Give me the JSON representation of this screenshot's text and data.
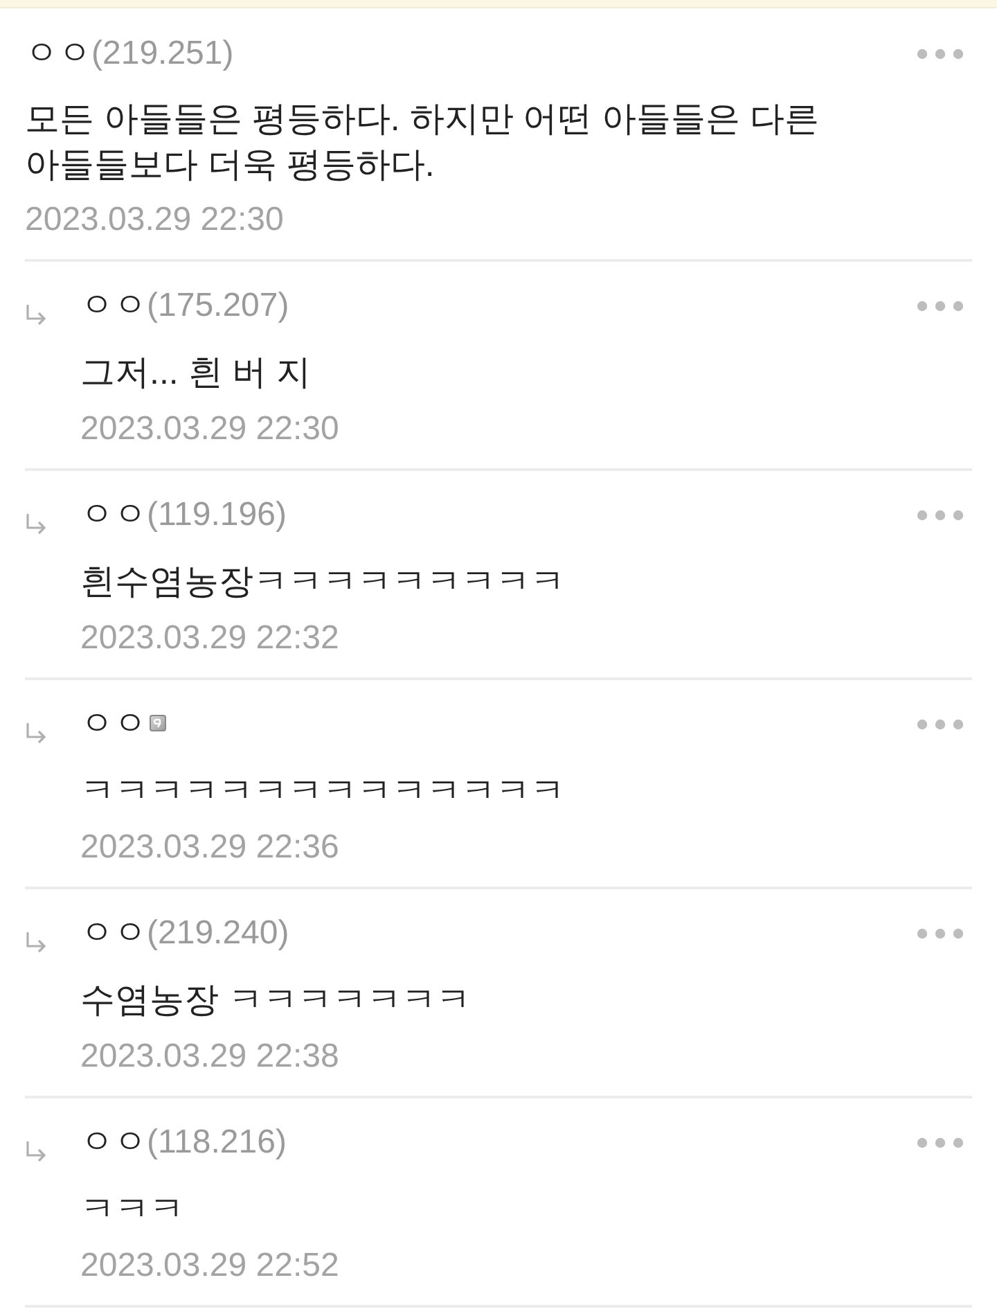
{
  "comment": {
    "nickname": "ㅇㅇ",
    "ip": "(219.251)",
    "text": "모든 아들들은 평등하다. 하지만 어떤 아들들은 다른 아들들보다 더욱 평등하다.",
    "date": "2023.03.29 22:30"
  },
  "replies": [
    {
      "kind": "guest",
      "nickname": "ㅇㅇ",
      "ip": "(175.207)",
      "text": "그저... 흰 버 지",
      "date": "2023.03.29 22:30"
    },
    {
      "kind": "guest",
      "nickname": "ㅇㅇ",
      "ip": "(119.196)",
      "text": "흰수염농장ㅋㅋㅋㅋㅋㅋㅋㅋㅋ",
      "date": "2023.03.29 22:32"
    },
    {
      "kind": "member",
      "nickname": "ㅇㅇ",
      "text": "ㅋㅋㅋㅋㅋㅋㅋㅋㅋㅋㅋㅋㅋㅋ",
      "date": "2023.03.29 22:36"
    },
    {
      "kind": "guest",
      "nickname": "ㅇㅇ",
      "ip": "(219.240)",
      "text": "수염농장 ㅋㅋㅋㅋㅋㅋㅋ",
      "date": "2023.03.29 22:38"
    },
    {
      "kind": "guest",
      "nickname": "ㅇㅇ",
      "ip": "(118.216)",
      "text": "ㅋㅋㅋ",
      "date": "2023.03.29 22:52"
    }
  ]
}
